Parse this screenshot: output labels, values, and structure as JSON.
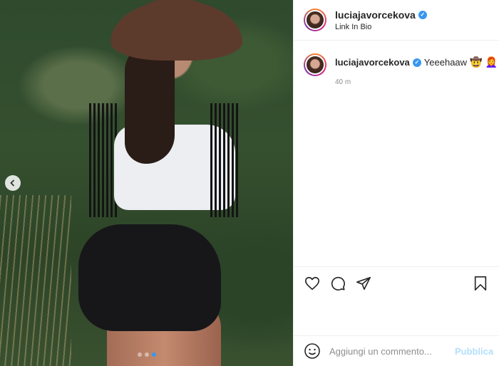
{
  "post": {
    "media": {
      "carousel_dots": 3,
      "active_dot_index": 2
    },
    "header": {
      "username": "luciajavorcekova",
      "location": "Link In Bio"
    },
    "caption": {
      "username": "luciajavorcekova",
      "text": "Yeeehaaw",
      "emojis": [
        "🤠",
        "👩‍🦰"
      ],
      "time": "40 m"
    },
    "actions": {
      "icons": [
        "heart-icon",
        "comment-icon",
        "share-icon",
        "bookmark-icon"
      ]
    },
    "comment_box": {
      "placeholder": "Aggiungi un commento...",
      "publish_label": "Pubblica"
    }
  },
  "colors": {
    "accent": "#3897f0",
    "publish_disabled": "#b2dffc",
    "border": "#efefef",
    "muted": "#8e8e8e"
  }
}
